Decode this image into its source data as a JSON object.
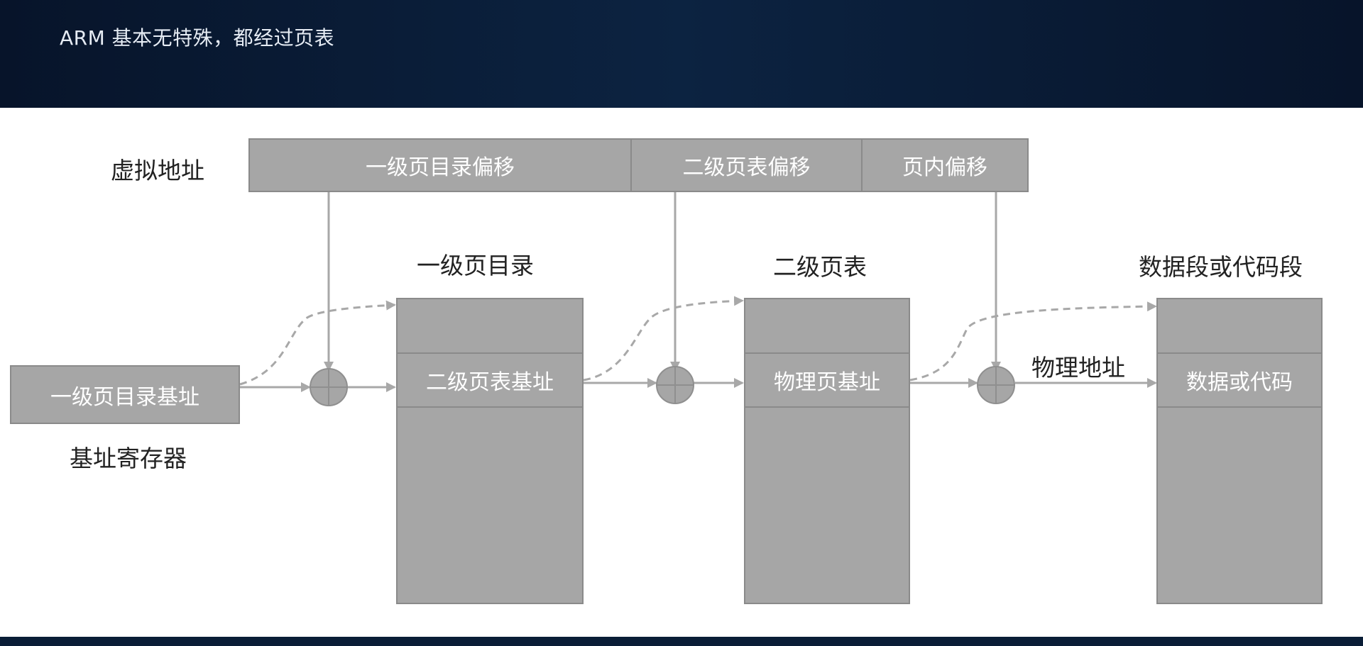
{
  "header": {
    "title": "ARM 基本无特殊，都经过页表"
  },
  "diagram": {
    "virtual_address_label": "虚拟地址",
    "virtual_address_fields": [
      "一级页目录偏移",
      "二级页表偏移",
      "页内偏移"
    ],
    "base_register": {
      "value": "一级页目录基址",
      "label": "基址寄存器"
    },
    "tables": [
      {
        "title": "一级页目录",
        "entry": "二级页表基址"
      },
      {
        "title": "二级页表",
        "entry": "物理页基址"
      },
      {
        "title": "数据段或代码段",
        "entry": "数据或代码"
      }
    ],
    "physical_address_label": "物理地址"
  },
  "colors": {
    "box_fill": "#a6a6a6",
    "box_border": "#8a8a8a",
    "arrow": "#a8a8a8",
    "header_bg": "#0c2341"
  }
}
